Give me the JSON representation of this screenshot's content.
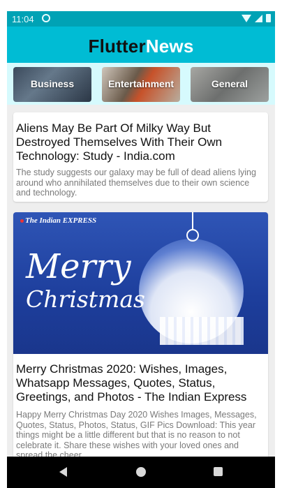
{
  "status": {
    "time": "11:04"
  },
  "app": {
    "title_part1": "Flutter",
    "title_part2": "News"
  },
  "categories": [
    {
      "label": "Business"
    },
    {
      "label": "Entertainment"
    },
    {
      "label": "General"
    }
  ],
  "articles": [
    {
      "title": "Aliens May Be Part Of Milky Way But Destroyed Themselves With Their Own Technology: Study - India.com",
      "description": "The study suggests our galaxy may be full of dead aliens lying around who annihilated themselves due to their own science and technology."
    },
    {
      "image_brand": "The Indian EXPRESS",
      "image_text_1": "Merry",
      "image_text_2": "Christmas",
      "title": "Merry Christmas 2020: Wishes, Images, Whatsapp Messages, Quotes, Status, Greetings, and Photos - The Indian Express",
      "description": "Happy Merry Christmas Day 2020 Wishes Images, Messages, Quotes, Status, Photos, Status, GIF Pics Download: This year things might be a little different but that is no reason to not celebrate it. Share these wishes with your loved ones and spread the cheer"
    }
  ],
  "colors": {
    "accent": "#00bcd4",
    "status_bar": "#00a2b5",
    "category_strip": "#d6fafd"
  }
}
